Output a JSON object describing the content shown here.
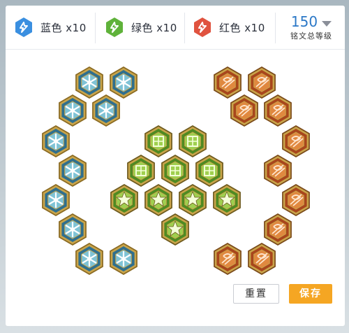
{
  "summary": {
    "blue_label": "蓝色 x10",
    "green_label": "绿色 x10",
    "red_label": "红色 x10",
    "total_level": "150",
    "total_caption": "铭文总等级"
  },
  "buttons": {
    "reset_label": "重置",
    "save_label": "保存"
  },
  "colors": {
    "blue": "#3a8fe0",
    "green": "#5fb23a",
    "red": "#e0533f",
    "accent": "#2b78c7",
    "save": "#f5a623"
  },
  "icons": {
    "blue": "blue-rune-icon",
    "green": "green-rune-icon",
    "red": "red-rune-icon",
    "dropdown": "chevron-down-icon"
  }
}
